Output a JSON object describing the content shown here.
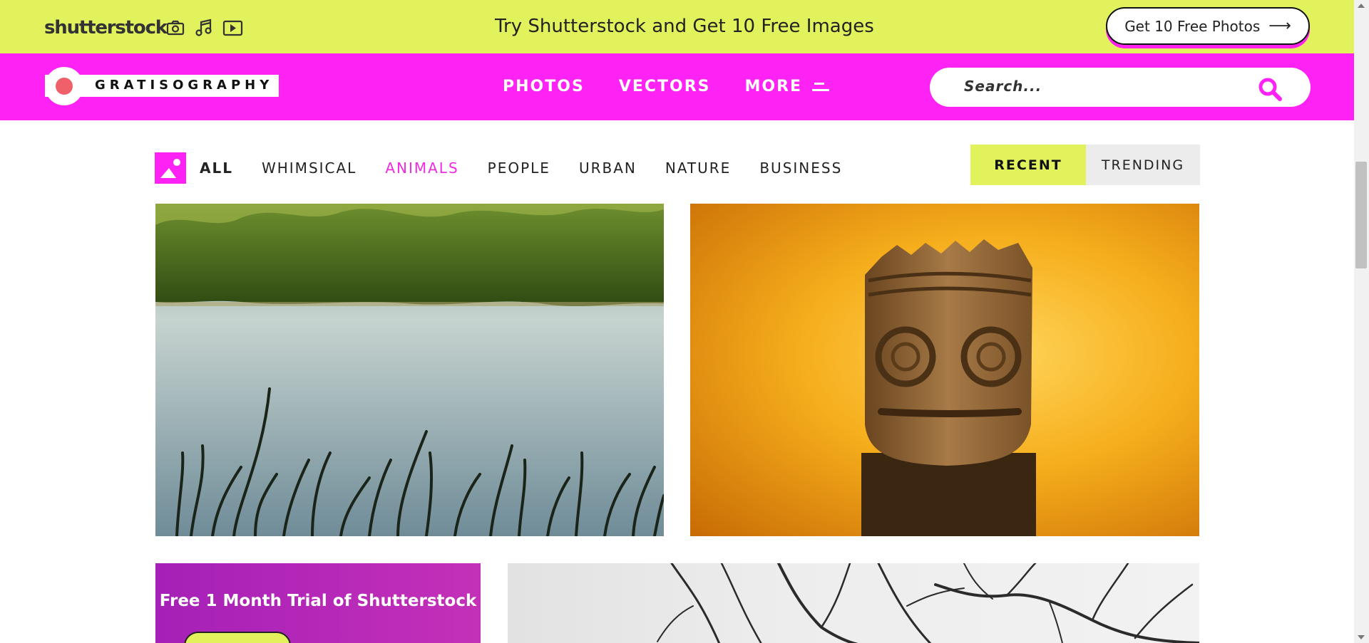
{
  "promo_bar": {
    "brand": "shutterstock",
    "tagline": "Try Shutterstock and Get 10 Free Images",
    "cta_label": "Get 10 Free Photos",
    "cta_arrow": "⟶",
    "icons": [
      "camera-icon",
      "music-note-icon",
      "video-play-icon"
    ]
  },
  "header": {
    "logo_text": "GRATISOGRAPHY",
    "nav": [
      {
        "label": "PHOTOS"
      },
      {
        "label": "VECTORS"
      },
      {
        "label": "MORE"
      }
    ],
    "search_placeholder": "Search..."
  },
  "filters": {
    "categories": [
      {
        "label": "ALL"
      },
      {
        "label": "WHIMSICAL"
      },
      {
        "label": "ANIMALS"
      },
      {
        "label": "PEOPLE"
      },
      {
        "label": "URBAN"
      },
      {
        "label": "NATURE"
      },
      {
        "label": "BUSINESS"
      }
    ],
    "sort": {
      "recent": "RECENT",
      "trending": "TRENDING"
    }
  },
  "promo_card": {
    "title": "Free 1 Month Trial of Shutterstock"
  },
  "colors": {
    "accent_magenta": "#ff22f5",
    "accent_lime": "#e1f25c",
    "active_filter": "#f02be0"
  }
}
